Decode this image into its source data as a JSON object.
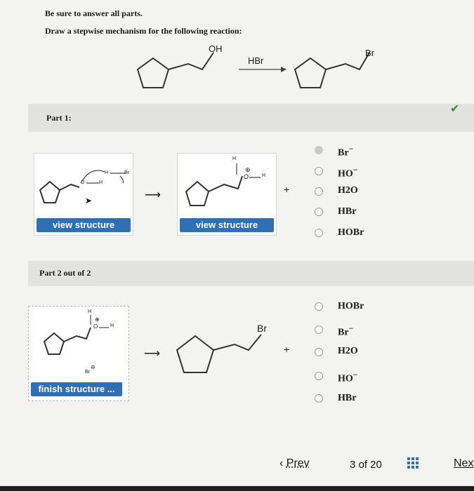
{
  "instructions": {
    "line1": "Be sure to answer all parts.",
    "line2": "Draw a stepwise mechanism for the following reaction:"
  },
  "reaction": {
    "reactant_label": "OH",
    "reagent": "HBr",
    "product_label": "Br"
  },
  "part1": {
    "title": "Part 1:",
    "button1": "view structure",
    "button2": "view structure",
    "plus": "+",
    "options": [
      "Br",
      "HO",
      "H2O",
      "HBr",
      "HOBr"
    ],
    "labels": {
      "h": "H",
      "br": "Br",
      "o": "O",
      "charge": "⊕"
    }
  },
  "part2": {
    "title": "Part 2 out of 2",
    "button": "finish structure ...",
    "product_label": "Br",
    "plus": "+",
    "options": [
      "HOBr",
      "Br",
      "H2O",
      "HO",
      "HBr"
    ],
    "labels": {
      "h": "H",
      "o": "O",
      "br": "Br",
      "charge": "⊕",
      "neg": "⊖"
    }
  },
  "nav": {
    "prev": "Prev",
    "page": "3 of 20",
    "next": "Nex"
  },
  "colors": {
    "accent_blue": "#2f6fb5",
    "check_green": "#3a8a2e"
  }
}
